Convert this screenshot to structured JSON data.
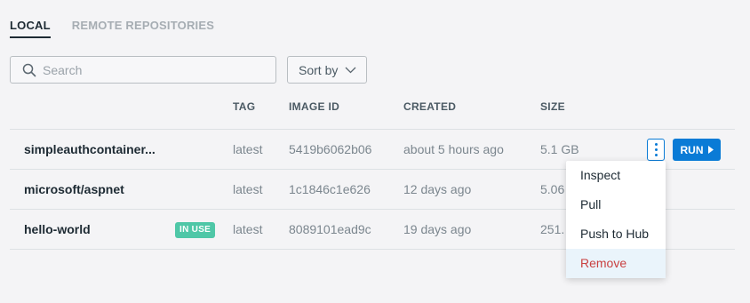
{
  "tabs": [
    {
      "label": "LOCAL",
      "active": true
    },
    {
      "label": "REMOTE REPOSITORIES",
      "active": false
    }
  ],
  "search": {
    "placeholder": "Search",
    "value": ""
  },
  "sort": {
    "label": "Sort by"
  },
  "table": {
    "columns": [
      "TAG",
      "IMAGE ID",
      "CREATED",
      "SIZE"
    ],
    "rows": [
      {
        "name": "simpleauthcontainer...",
        "badge": "",
        "tag": "latest",
        "image_id": "5419b6062b06",
        "created": "about 5 hours ago",
        "size": "5.1 GB"
      },
      {
        "name": "microsoft/aspnet",
        "badge": "",
        "tag": "latest",
        "image_id": "1c1846c1e626",
        "created": "12 days ago",
        "size": "5.06"
      },
      {
        "name": "hello-world",
        "badge": "IN USE",
        "tag": "latest",
        "image_id": "8089101ead9c",
        "created": "19 days ago",
        "size": "251."
      }
    ]
  },
  "actions": {
    "run_label": "RUN"
  },
  "context_menu": {
    "items": [
      "Inspect",
      "Pull",
      "Push to Hub",
      "Remove"
    ]
  },
  "colors": {
    "accent": "#0a7bd6",
    "badge": "#4fc7a7",
    "danger": "#c94141"
  }
}
